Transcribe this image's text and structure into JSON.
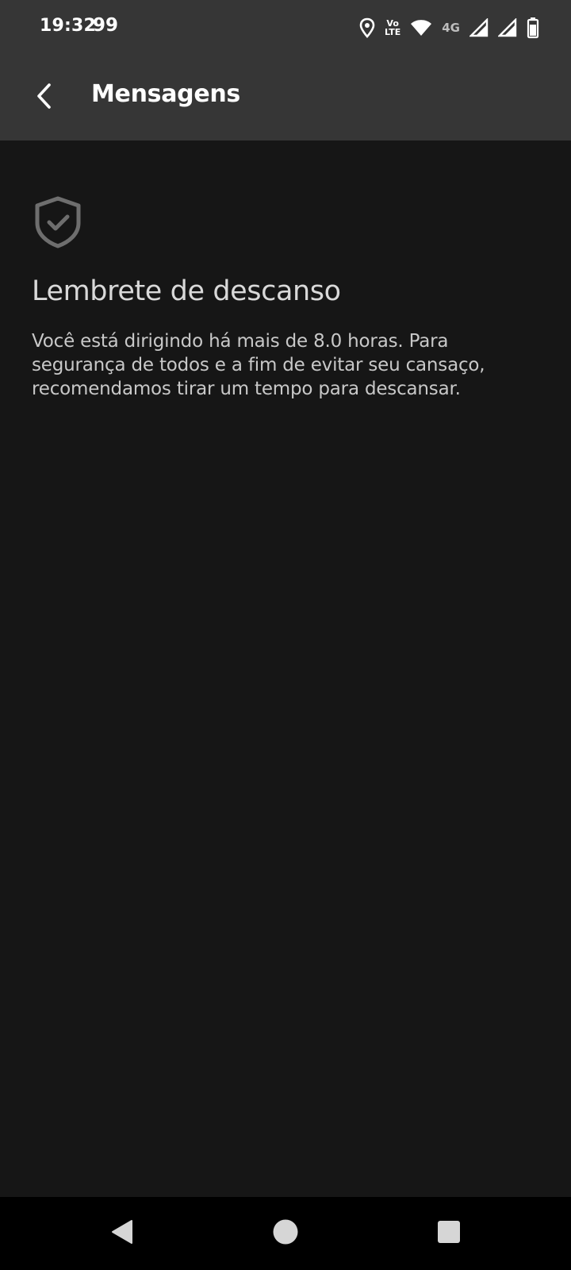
{
  "status_bar": {
    "time": "19:32",
    "badge": "99",
    "volte_line1": "Vo",
    "volte_line2": "LTE",
    "network": "4G",
    "icons": [
      "location-icon",
      "volte-icon",
      "wifi-icon",
      "signal-icon",
      "signal-icon",
      "battery-icon"
    ]
  },
  "app_bar": {
    "back_icon": "chevron-left-icon",
    "title": "Mensagens"
  },
  "message": {
    "icon": "shield-check-icon",
    "title": "Lembrete de descanso",
    "body": "Você está dirigindo há mais de 8.0 horas. Para segurança de todos e a fim de evitar seu cansaço, recomendamos tirar um tempo para descansar."
  },
  "nav_bar": {
    "icons": [
      "back-triangle-icon",
      "home-circle-icon",
      "recents-square-icon"
    ]
  },
  "colors": {
    "top_bar": "#363636",
    "background": "#161616",
    "nav_bar": "#000000",
    "text_primary": "#ffffff",
    "text_secondary": "#c8c8c8"
  }
}
